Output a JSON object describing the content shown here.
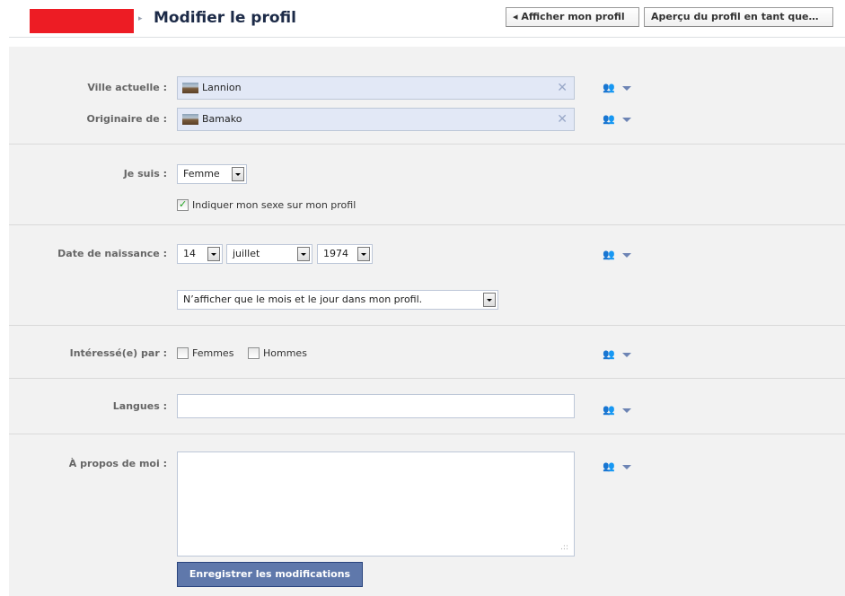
{
  "header": {
    "title": "Modifier le profil",
    "breadcrumb_arrow": "▸",
    "view_profile_button": "◂ Afficher mon profil",
    "preview_button": "Aperçu du profil en tant que…"
  },
  "form": {
    "current_city": {
      "label": "Ville actuelle :",
      "value": "Lannion"
    },
    "hometown": {
      "label": "Originaire de :",
      "value": "Bamako"
    },
    "sex": {
      "label": "Je suis :",
      "value": "Femme",
      "show_checkbox_label": "Indiquer mon sexe sur mon profil",
      "show_checked": true
    },
    "birthday": {
      "label": "Date de naissance :",
      "day": "14",
      "month": "juillet",
      "year": "1974",
      "display_option": "N’afficher que le mois et le jour dans mon profil."
    },
    "interested_in": {
      "label": "Intéressé(e) par :",
      "women_label": "Femmes",
      "men_label": "Hommes",
      "women_checked": false,
      "men_checked": false
    },
    "languages": {
      "label": "Langues :",
      "value": ""
    },
    "about": {
      "label": "À propos de moi :",
      "value": ""
    },
    "save_button": "Enregistrer les modifications"
  },
  "icons": {
    "privacy": "people-icon",
    "privacy_dropdown": "chevron-down-icon",
    "remove": "close-icon",
    "token_image": "location-thumbnail"
  },
  "colors": {
    "title": "#1c2a47",
    "token_bg": "#e2e8f6",
    "save_button_bg": "#5f78ab",
    "panel_bg": "#f2f2f2",
    "redaction": "#ed1c24"
  }
}
